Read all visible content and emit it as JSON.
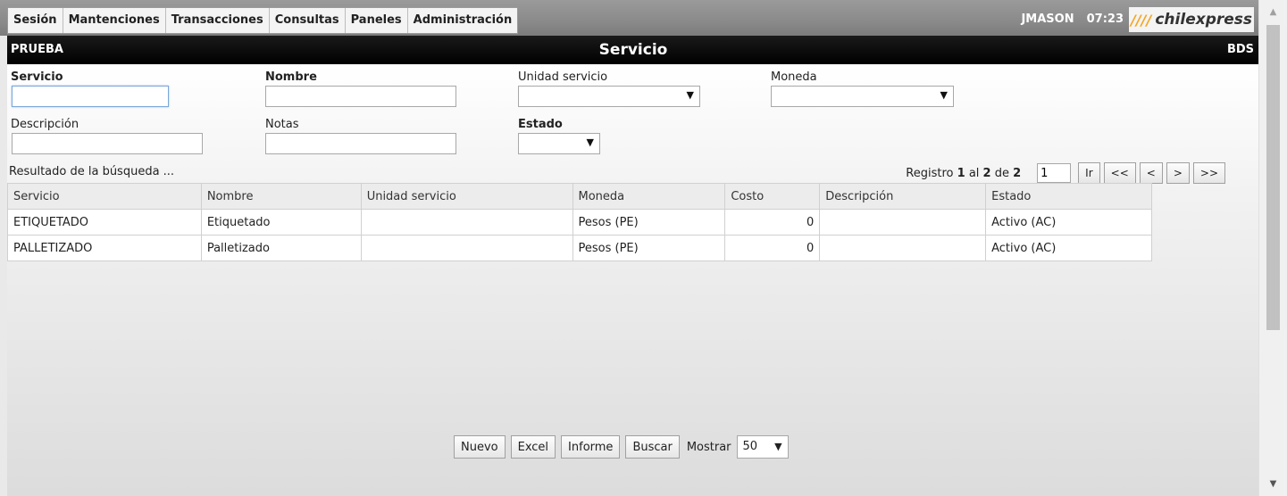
{
  "menu": {
    "items": [
      "Sesión",
      "Mantenciones",
      "Transacciones",
      "Consultas",
      "Paneles",
      "Administración"
    ]
  },
  "user": {
    "name": "JMASON",
    "time": "07:23"
  },
  "logo": {
    "text": "chilexpress",
    "accent_color": "#f5a623"
  },
  "titlebar": {
    "left": "PRUEBA",
    "title": "Servicio",
    "right": "BDS"
  },
  "filters": {
    "servicio_label": "Servicio",
    "servicio_value": "",
    "nombre_label": "Nombre",
    "nombre_value": "",
    "unidad_label": "Unidad servicio",
    "unidad_value": "",
    "moneda_label": "Moneda",
    "moneda_value": "",
    "descripcion_label": "Descripción",
    "descripcion_value": "",
    "notas_label": "Notas",
    "notas_value": "",
    "estado_label": "Estado",
    "estado_value": ""
  },
  "results": {
    "label": "Resultado de la búsqueda ...",
    "pager": {
      "registro": "Registro",
      "from": "1",
      "al": "al",
      "to": "2",
      "de": "de",
      "total": "2",
      "page_value": "1",
      "go_label": "Ir",
      "first_label": "<<",
      "prev_label": "<",
      "next_label": ">",
      "last_label": ">>"
    },
    "columns": [
      "Servicio",
      "Nombre",
      "Unidad servicio",
      "Moneda",
      "Costo",
      "Descripción",
      "Estado"
    ],
    "rows": [
      [
        "ETIQUETADO",
        "Etiquetado",
        "",
        "Pesos (PE)",
        "0",
        "",
        "Activo (AC)"
      ],
      [
        "PALLETIZADO",
        "Palletizado",
        "",
        "Pesos (PE)",
        "0",
        "",
        "Activo (AC)"
      ]
    ]
  },
  "actions": {
    "nuevo": "Nuevo",
    "excel": "Excel",
    "informe": "Informe",
    "buscar": "Buscar",
    "mostrar_label": "Mostrar",
    "mostrar_value": "50"
  },
  "icons": {
    "dropdown": "dropdown-arrow-icon",
    "scroll_up": "scroll-up-icon",
    "scroll_down": "scroll-down-icon"
  }
}
